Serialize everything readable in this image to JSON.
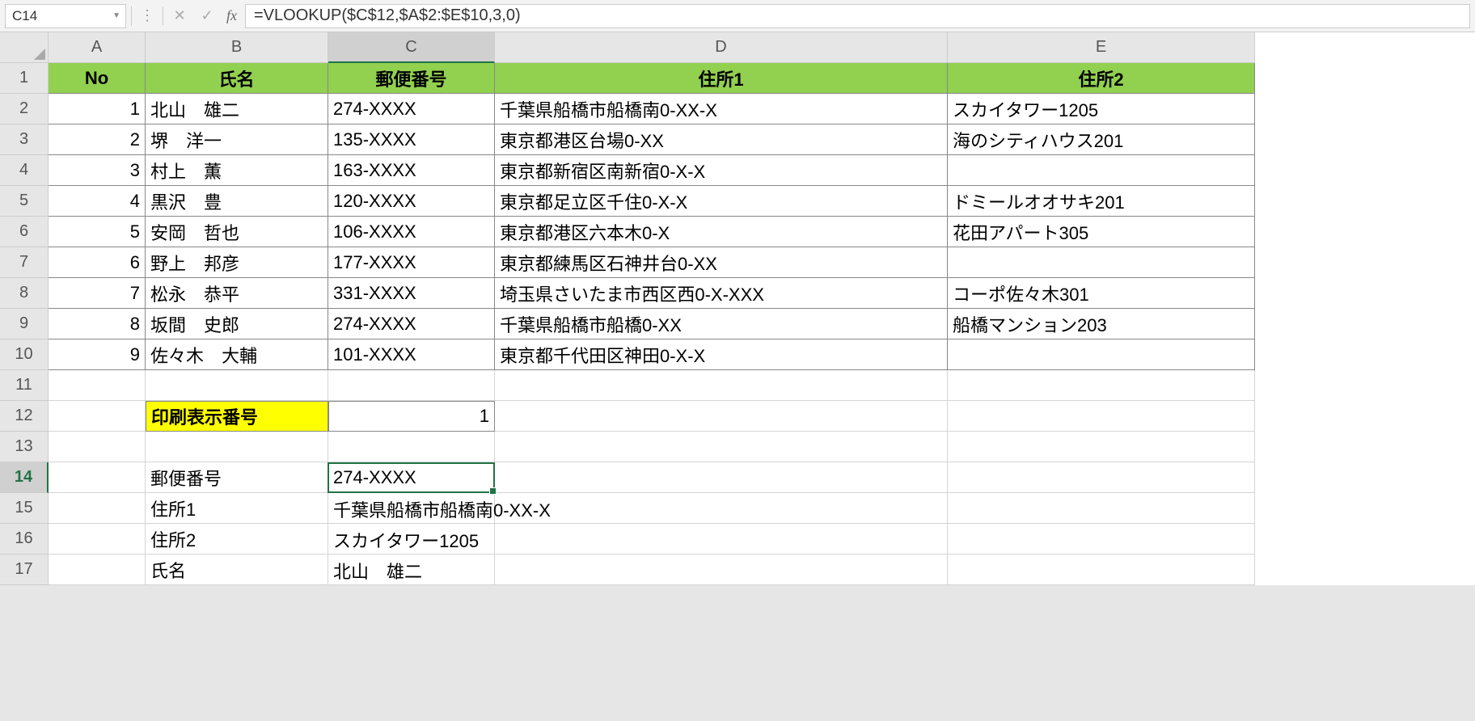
{
  "nameBox": "C14",
  "formula": "=VLOOKUP($C$12,$A$2:$E$10,3,0)",
  "columns": [
    "A",
    "B",
    "C",
    "D",
    "E"
  ],
  "rows": [
    "1",
    "2",
    "3",
    "4",
    "5",
    "6",
    "7",
    "8",
    "9",
    "10",
    "11",
    "12",
    "13",
    "14",
    "15",
    "16",
    "17"
  ],
  "headers": {
    "no": "No",
    "name": "氏名",
    "postal": "郵便番号",
    "addr1": "住所1",
    "addr2": "住所2"
  },
  "table": [
    {
      "no": "1",
      "name": "北山　雄二",
      "postal": "274-XXXX",
      "addr1": "千葉県船橋市船橋南0-XX-X",
      "addr2": "スカイタワー1205"
    },
    {
      "no": "2",
      "name": "堺　洋一",
      "postal": "135-XXXX",
      "addr1": "東京都港区台場0-XX",
      "addr2": "海のシティハウス201"
    },
    {
      "no": "3",
      "name": "村上　薫",
      "postal": "163-XXXX",
      "addr1": "東京都新宿区南新宿0-X-X",
      "addr2": ""
    },
    {
      "no": "4",
      "name": "黒沢　豊",
      "postal": "120-XXXX",
      "addr1": "東京都足立区千住0-X-X",
      "addr2": "ドミールオオサキ201"
    },
    {
      "no": "5",
      "name": "安岡　哲也",
      "postal": "106-XXXX",
      "addr1": "東京都港区六本木0-X",
      "addr2": "花田アパート305"
    },
    {
      "no": "6",
      "name": "野上　邦彦",
      "postal": "177-XXXX",
      "addr1": "東京都練馬区石神井台0-XX",
      "addr2": ""
    },
    {
      "no": "7",
      "name": "松永　恭平",
      "postal": "331-XXXX",
      "addr1": "埼玉県さいたま市西区西0-X-XXX",
      "addr2": "コーポ佐々木301"
    },
    {
      "no": "8",
      "name": "坂間　史郎",
      "postal": "274-XXXX",
      "addr1": "千葉県船橋市船橋0-XX",
      "addr2": "船橋マンション203"
    },
    {
      "no": "9",
      "name": "佐々木　大輔",
      "postal": "101-XXXX",
      "addr1": "東京都千代田区神田0-X-X",
      "addr2": ""
    }
  ],
  "printLabel": "印刷表示番号",
  "printNum": "1",
  "result": {
    "postalLabel": "郵便番号",
    "postal": "274-XXXX",
    "addr1Label": "住所1",
    "addr1": "千葉県船橋市船橋南0-XX-X",
    "addr2Label": "住所2",
    "addr2": "スカイタワー1205",
    "nameLabel": "氏名",
    "name": "北山　雄二"
  },
  "activeCol": "C",
  "activeRow": "14"
}
